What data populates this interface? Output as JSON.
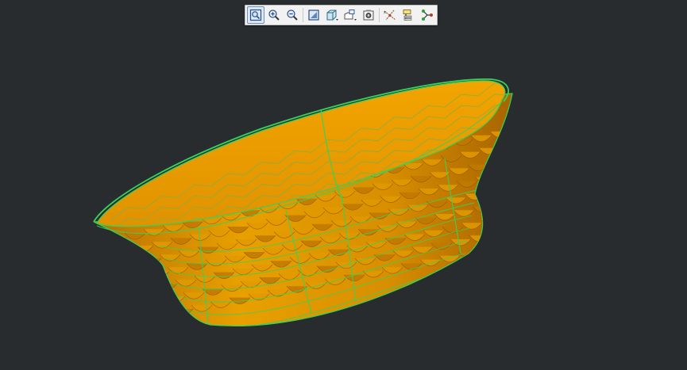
{
  "window": {
    "background": "#282c2e"
  },
  "toolbar": {
    "buttons": [
      {
        "id": "zoom-fit",
        "icon": "zoom-fit-icon",
        "active": true
      },
      {
        "id": "zoom-in",
        "icon": "zoom-in-icon"
      },
      {
        "id": "zoom-out",
        "icon": "zoom-out-icon"
      },
      {
        "id": "view-orientation",
        "icon": "view-orientation-icon"
      },
      {
        "id": "display-style",
        "icon": "display-style-icon",
        "has_dropdown": true
      },
      {
        "id": "view-mode",
        "icon": "view-mode-icon",
        "has_dropdown": true
      },
      {
        "id": "saved-views",
        "icon": "saved-views-icon"
      },
      {
        "id": "datum-display",
        "icon": "datum-display-icon"
      },
      {
        "id": "annotation-display",
        "icon": "annotation-display-icon"
      },
      {
        "id": "spin-center",
        "icon": "spin-center-icon"
      }
    ]
  },
  "model": {
    "shading_color": "#e39a00",
    "shading_dark": "#9a5a00",
    "edge_color": "#35d35a",
    "display_style": "shading with edges"
  }
}
